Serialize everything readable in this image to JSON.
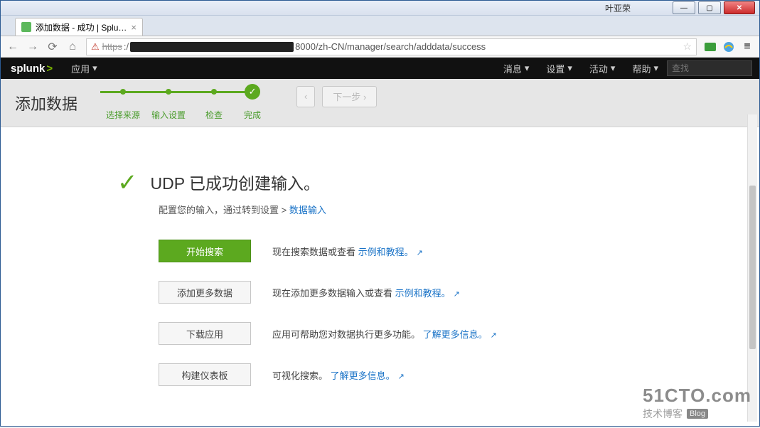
{
  "window": {
    "author": "叶亚荣"
  },
  "browser": {
    "tab_title": "添加数据 - 成功 | Splunk",
    "url_proto": "https",
    "url_suffix": "8000/zh-CN/manager/search/adddata/success"
  },
  "topnav": {
    "logo": "splunk",
    "app_menu": "应用",
    "menu_messages": "消息",
    "menu_settings": "设置",
    "menu_activity": "活动",
    "menu_help": "帮助",
    "search_placeholder": "查找"
  },
  "wizard": {
    "title": "添加数据",
    "steps": [
      "选择来源",
      "输入设置",
      "检查",
      "完成"
    ],
    "prev": "‹",
    "next": "下一步 ›"
  },
  "success": {
    "headline": "UDP 已成功创建输入。",
    "subtext_before": "配置您的输入，通过转到设置 > ",
    "subtext_link": "数据输入"
  },
  "actions": {
    "start_search": {
      "label": "开始搜索",
      "desc_before": "现在搜索数据或查看 ",
      "desc_link": "示例和教程。"
    },
    "add_more": {
      "label": "添加更多数据",
      "desc_before": "现在添加更多数据输入或查看 ",
      "desc_link": "示例和教程。"
    },
    "download_app": {
      "label": "下载应用",
      "desc_before": "应用可帮助您对数据执行更多功能。",
      "desc_link": "了解更多信息。"
    },
    "build_dashboard": {
      "label": "构建仪表板",
      "desc_before": "可视化搜索。",
      "desc_link": "了解更多信息。"
    }
  },
  "watermark": {
    "line1": "51CTO.com",
    "line2": "技术博客",
    "badge": "Blog"
  }
}
